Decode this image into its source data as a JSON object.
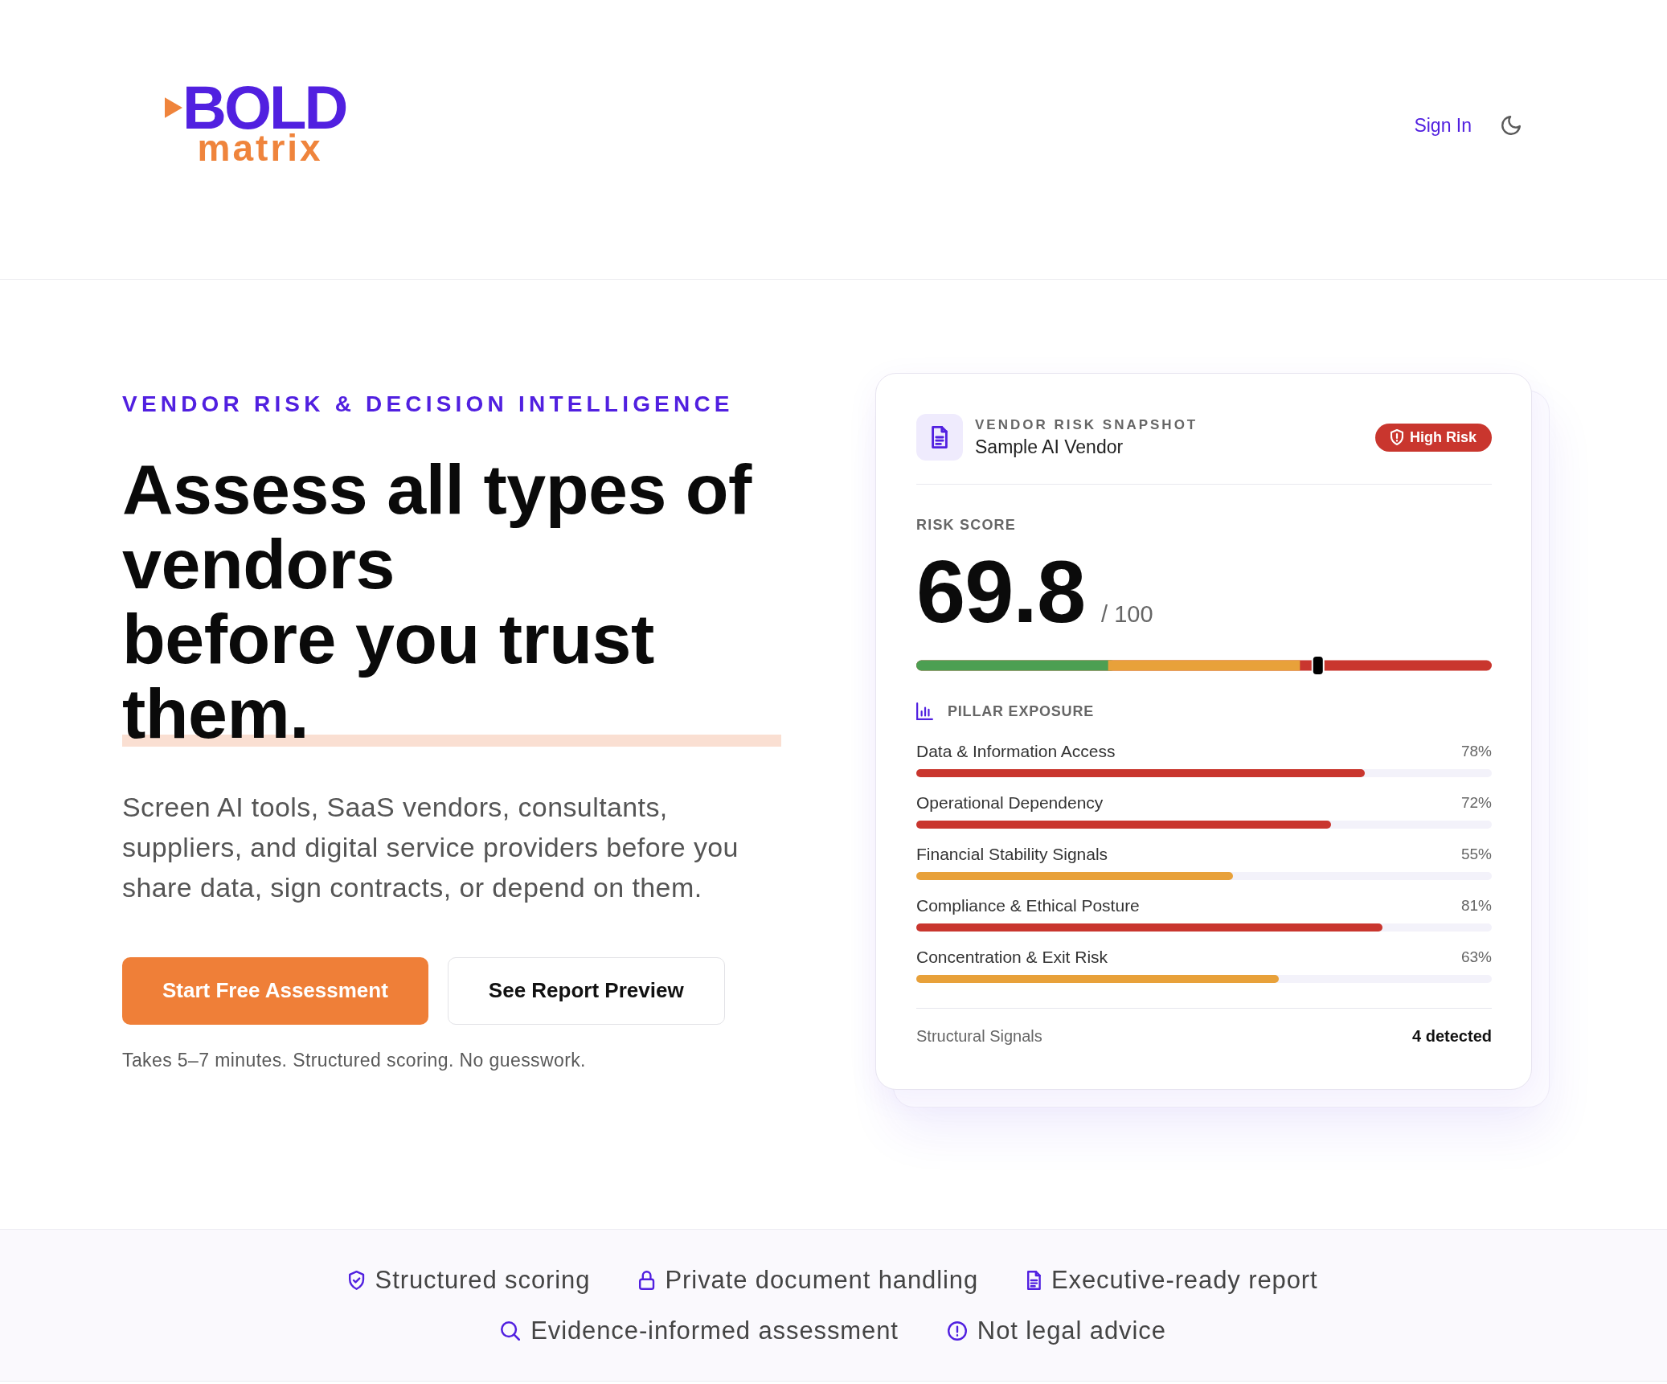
{
  "header": {
    "logo": {
      "wordmark": "BOLD",
      "tagline": "matrix"
    },
    "sign_in": "Sign In"
  },
  "hero": {
    "eyebrow": "VENDOR RISK & DECISION INTELLIGENCE",
    "headline": [
      {
        "text": "Assess all types of vendors",
        "highlighted": false
      },
      {
        "text": "before you trust them.",
        "highlighted": true
      }
    ],
    "description": "Screen AI tools, SaaS vendors, consultants, suppliers, and digital service providers before you share data, sign contracts, or depend on them.",
    "buttons": [
      {
        "label": "Start Free Assessment",
        "kind": "primary"
      },
      {
        "label": "See Report Preview",
        "kind": "secondary"
      }
    ],
    "note": "Takes 5–7 minutes. Structured scoring. No guesswork."
  },
  "snapshot": {
    "eyebrow": "VENDOR RISK SNAPSHOT",
    "vendor": "Sample AI Vendor",
    "badge": "High Risk",
    "score_label": "RISK SCORE",
    "score": "69.8",
    "score_max": "/ 100",
    "score_meter": {
      "level": 0.698
    },
    "pillars_title": "PILLAR EXPOSURE",
    "pillars": [
      {
        "name": "Data & Information Access",
        "value": "78%",
        "level": 0.78,
        "color": "#c9362e"
      },
      {
        "name": "Operational Dependency",
        "value": "72%",
        "level": 0.72,
        "color": "#c9362e"
      },
      {
        "name": "Financial Stability Signals",
        "value": "55%",
        "level": 0.55,
        "color": "#e8a13a"
      },
      {
        "name": "Compliance & Ethical Posture",
        "value": "81%",
        "level": 0.81,
        "color": "#c9362e"
      },
      {
        "name": "Concentration & Exit Risk",
        "value": "63%",
        "level": 0.63,
        "color": "#e8a13a"
      }
    ],
    "signals": {
      "label": "Structural Signals",
      "value": "4 detected"
    }
  },
  "trust_items": [
    {
      "kind": "shield",
      "label": "Structured scoring"
    },
    {
      "kind": "lock",
      "label": "Private document handling"
    },
    {
      "kind": "document",
      "label": "Executive-ready report"
    },
    {
      "kind": "search",
      "label": "Evidence-informed assessment"
    },
    {
      "kind": "alert",
      "label": "Not legal advice"
    }
  ]
}
